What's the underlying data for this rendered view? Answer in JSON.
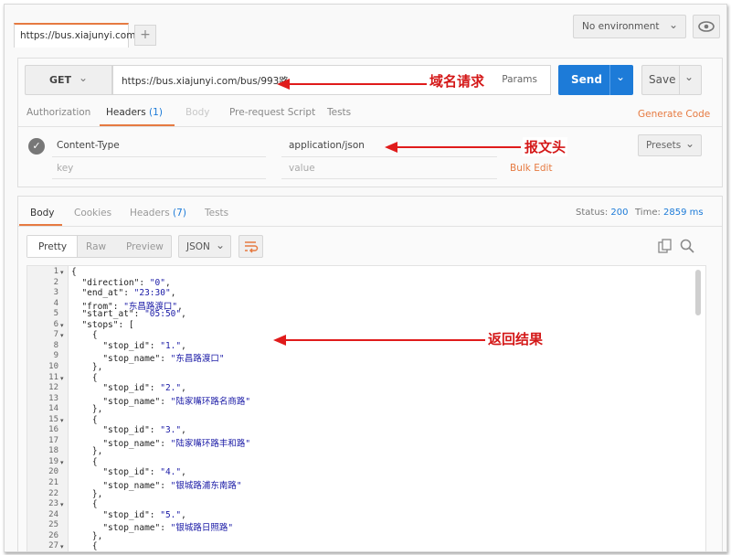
{
  "tabs": {
    "active_label": "https://bus.xiajunyi.com",
    "add_label": "+"
  },
  "environment": {
    "selected": "No environment"
  },
  "request": {
    "method": "GET",
    "url": "https://bus.xiajunyi.com/bus/993路",
    "params_label": "Params",
    "send_label": "Send",
    "save_label": "Save"
  },
  "request_tabs": {
    "authorization": "Authorization",
    "headers": "Headers",
    "headers_count": "(1)",
    "body": "Body",
    "prerequest": "Pre-request Script",
    "tests": "Tests",
    "generate_code": "Generate Code"
  },
  "headers_table": {
    "key": "Content-Type",
    "value": "application/json",
    "key_placeholder": "key",
    "value_placeholder": "value",
    "bulk_edit": "Bulk Edit",
    "presets": "Presets"
  },
  "response_tabs": {
    "body": "Body",
    "cookies": "Cookies",
    "headers": "Headers",
    "headers_count": "(7)",
    "tests": "Tests",
    "status_label": "Status:",
    "status_value": "200",
    "time_label": "Time:",
    "time_value": "2859 ms"
  },
  "format": {
    "pretty": "Pretty",
    "raw": "Raw",
    "preview": "Preview",
    "type": "JSON"
  },
  "code_lines": [
    "{",
    "  \"direction\": \"0\",",
    "  \"end_at\": \"23:30\",",
    "  \"from\": \"东昌路渡口\",",
    "  \"start_at\": \"05:50\",",
    "  \"stops\": [",
    "    {",
    "      \"stop_id\": \"1.\",",
    "      \"stop_name\": \"东昌路渡口\"",
    "    },",
    "    {",
    "      \"stop_id\": \"2.\",",
    "      \"stop_name\": \"陆家嘴环路名商路\"",
    "    },",
    "    {",
    "      \"stop_id\": \"3.\",",
    "      \"stop_name\": \"陆家嘴环路丰和路\"",
    "    },",
    "    {",
    "      \"stop_id\": \"4.\",",
    "      \"stop_name\": \"银城路浦东南路\"",
    "    },",
    "    {",
    "      \"stop_id\": \"5.\",",
    "      \"stop_name\": \"银城路日照路\"",
    "    },",
    "    {"
  ],
  "fold_lines": [
    1,
    6,
    7,
    11,
    15,
    19,
    23,
    27
  ],
  "annotations": {
    "domain_request": "域名请求",
    "headers": "报文头",
    "result": "返回结果"
  }
}
